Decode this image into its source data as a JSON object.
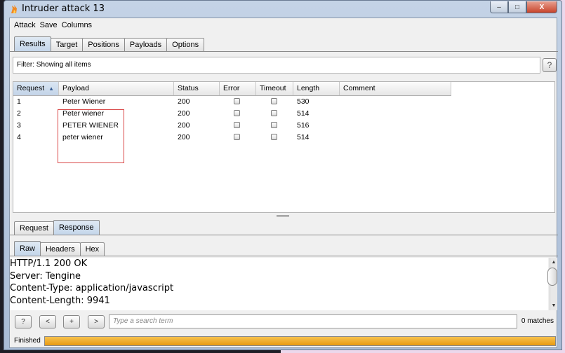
{
  "window": {
    "title": "Intruder attack 13",
    "minimize": "–",
    "maximize": "□",
    "close": "X"
  },
  "menu": [
    "Attack",
    "Save",
    "Columns"
  ],
  "main_tabs": [
    "Results",
    "Target",
    "Positions",
    "Payloads",
    "Options"
  ],
  "filter": {
    "text": "Filter: Showing all items",
    "help": "?"
  },
  "table": {
    "headers": [
      "Request",
      "Payload",
      "Status",
      "Error",
      "Timeout",
      "Length",
      "Comment"
    ],
    "sort_indicator": "▲",
    "rows": [
      {
        "request": "1",
        "payload": "Peter Wiener",
        "status": "200",
        "error": false,
        "timeout": false,
        "length": "530",
        "comment": ""
      },
      {
        "request": "2",
        "payload": "Peter wiener",
        "status": "200",
        "error": false,
        "timeout": false,
        "length": "514",
        "comment": ""
      },
      {
        "request": "3",
        "payload": "PETER WIENER",
        "status": "200",
        "error": false,
        "timeout": false,
        "length": "516",
        "comment": ""
      },
      {
        "request": "4",
        "payload": "peter wiener",
        "status": "200",
        "error": false,
        "timeout": false,
        "length": "514",
        "comment": ""
      }
    ]
  },
  "detail_tabs": [
    "Request",
    "Response"
  ],
  "view_tabs": [
    "Raw",
    "Headers",
    "Hex"
  ],
  "response_lines": [
    "HTTP/1.1 200 OK",
    "Server: Tengine",
    "Content-Type: application/javascript",
    "Content-Length: 9941"
  ],
  "search": {
    "help": "?",
    "prev": "<",
    "add": "+",
    "next": ">",
    "placeholder": "Type a search term",
    "matches": "0 matches"
  },
  "status": {
    "label": "Finished",
    "progress": 1.0
  },
  "colors": {
    "highlight_box": "#d94848",
    "progress": "#f0a82a",
    "active_tab": "#c4d6ea"
  }
}
